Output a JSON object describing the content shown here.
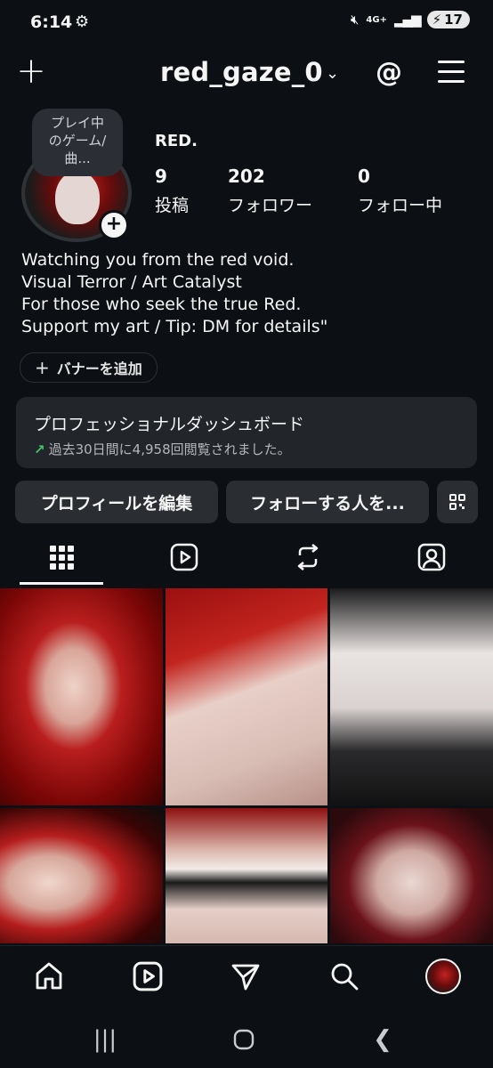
{
  "status_bar": {
    "time": "6:14",
    "network": "4G+",
    "battery": "17"
  },
  "header": {
    "username": "red_gaze_0"
  },
  "profile": {
    "note": [
      "プレイ中",
      "のゲーム/",
      "曲..."
    ],
    "display_name": "RED.",
    "stats": [
      {
        "value": "9",
        "label": "投稿"
      },
      {
        "value": "202",
        "label": "フォロワー"
      },
      {
        "value": "0",
        "label": "フォロー中"
      }
    ],
    "bio": [
      "Watching you from the red void.",
      "Visual Terror / Art Catalyst",
      "For those who seek the true Red.",
      "Support my art / Tip: DM for details\""
    ],
    "add_banner_label": "バナーを追加"
  },
  "dashboard": {
    "title": "プロフェッショナルダッシュボード",
    "subtitle": "過去30日間に4,958回閲覧されました。"
  },
  "actions": {
    "edit_profile": "プロフィールを編集",
    "discover_people": "フォローする人を..."
  },
  "tabs": [
    "grid",
    "reels",
    "reposts",
    "tagged"
  ],
  "posts_count_visible": 6,
  "bottom_nav": [
    "home",
    "reels",
    "messages",
    "search",
    "profile"
  ],
  "system_nav": [
    "recents",
    "home",
    "back"
  ]
}
